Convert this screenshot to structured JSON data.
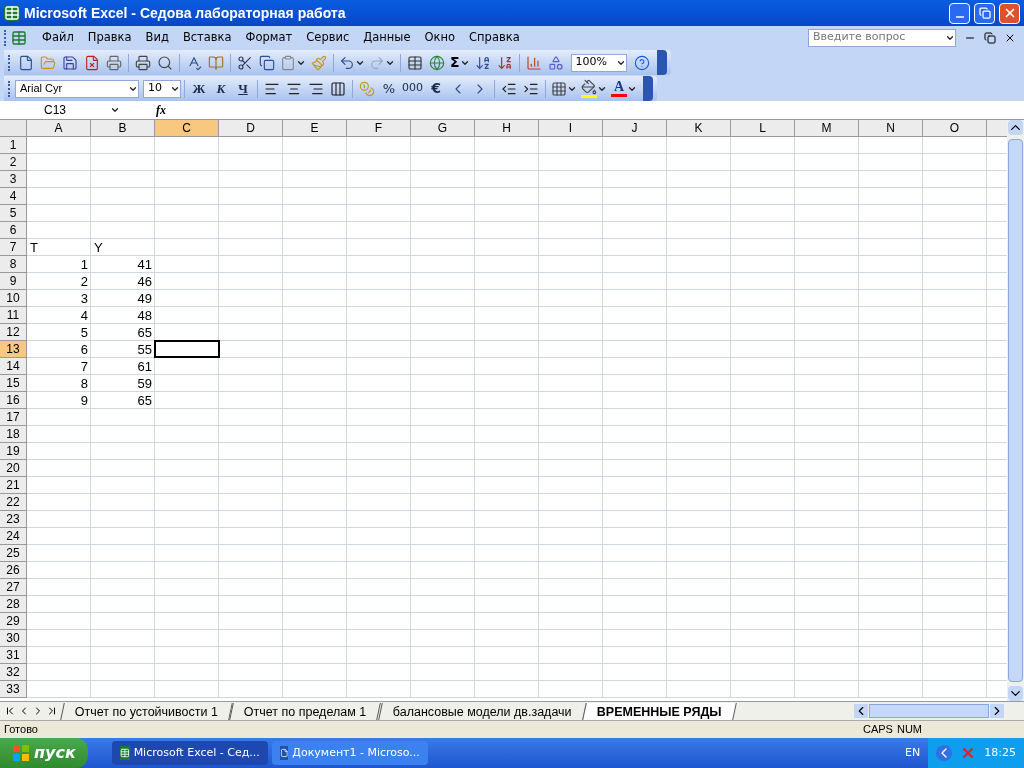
{
  "window": {
    "title": "Microsoft Excel - Седова лабораторная работа"
  },
  "menu": [
    "Файл",
    "Правка",
    "Вид",
    "Вставка",
    "Формат",
    "Сервис",
    "Данные",
    "Окно",
    "Справка"
  ],
  "help_search": {
    "placeholder": "Введите вопрос"
  },
  "toolbar_standard": {
    "sum": "Σ",
    "zoom": "100%"
  },
  "toolbar_formatting": {
    "font": "Arial Cyr",
    "size": "10",
    "bold": "Ж",
    "italic": "К",
    "underline": "Ч",
    "percent": "%",
    "thousands": "000",
    "euro": "€",
    "font_color": "A"
  },
  "formula_bar": {
    "name_box": "C13",
    "fx": "fx"
  },
  "sheet": {
    "columns": [
      {
        "label": "A",
        "selected": false
      },
      {
        "label": "B",
        "selected": false
      },
      {
        "label": "C",
        "selected": true
      },
      {
        "label": "D",
        "selected": false
      },
      {
        "label": "E",
        "selected": false
      },
      {
        "label": "F",
        "selected": false
      },
      {
        "label": "G",
        "selected": false
      },
      {
        "label": "H",
        "selected": false
      },
      {
        "label": "I",
        "selected": false
      },
      {
        "label": "J",
        "selected": false
      },
      {
        "label": "K",
        "selected": false
      },
      {
        "label": "L",
        "selected": false
      },
      {
        "label": "M",
        "selected": false
      },
      {
        "label": "N",
        "selected": false
      },
      {
        "label": "O",
        "selected": false
      }
    ],
    "rows": [
      {
        "label": "1",
        "selected": false
      },
      {
        "label": "2",
        "selected": false
      },
      {
        "label": "3",
        "selected": false
      },
      {
        "label": "4",
        "selected": false
      },
      {
        "label": "5",
        "selected": false
      },
      {
        "label": "6",
        "selected": false
      },
      {
        "label": "7",
        "selected": false,
        "cells": [
          {
            "value": "T",
            "kind": "text"
          },
          {
            "value": "Y",
            "kind": "text"
          }
        ]
      },
      {
        "label": "8",
        "selected": false,
        "cells": [
          {
            "value": "1",
            "kind": "number"
          },
          {
            "value": "41",
            "kind": "number"
          }
        ]
      },
      {
        "label": "9",
        "selected": false,
        "cells": [
          {
            "value": "2",
            "kind": "number"
          },
          {
            "value": "46",
            "kind": "number"
          }
        ]
      },
      {
        "label": "10",
        "selected": false,
        "cells": [
          {
            "value": "3",
            "kind": "number"
          },
          {
            "value": "49",
            "kind": "number"
          }
        ]
      },
      {
        "label": "11",
        "selected": false,
        "cells": [
          {
            "value": "4",
            "kind": "number"
          },
          {
            "value": "48",
            "kind": "number"
          }
        ]
      },
      {
        "label": "12",
        "selected": false,
        "cells": [
          {
            "value": "5",
            "kind": "number"
          },
          {
            "value": "65",
            "kind": "number"
          }
        ]
      },
      {
        "label": "13",
        "selected": true,
        "cells": [
          {
            "value": "6",
            "kind": "number"
          },
          {
            "value": "55",
            "kind": "number"
          }
        ]
      },
      {
        "label": "14",
        "selected": false,
        "cells": [
          {
            "value": "7",
            "kind": "number"
          },
          {
            "value": "61",
            "kind": "number"
          }
        ]
      },
      {
        "label": "15",
        "selected": false,
        "cells": [
          {
            "value": "8",
            "kind": "number"
          },
          {
            "value": "59",
            "kind": "number"
          }
        ]
      },
      {
        "label": "16",
        "selected": false,
        "cells": [
          {
            "value": "9",
            "kind": "number"
          },
          {
            "value": "65",
            "kind": "number"
          }
        ]
      },
      {
        "label": "17",
        "selected": false
      },
      {
        "label": "18",
        "selected": false
      },
      {
        "label": "19",
        "selected": false
      },
      {
        "label": "20",
        "selected": false
      },
      {
        "label": "21",
        "selected": false
      },
      {
        "label": "22",
        "selected": false
      },
      {
        "label": "23",
        "selected": false
      },
      {
        "label": "24",
        "selected": false
      },
      {
        "label": "25",
        "selected": false
      },
      {
        "label": "26",
        "selected": false
      },
      {
        "label": "27",
        "selected": false
      },
      {
        "label": "28",
        "selected": false
      },
      {
        "label": "29",
        "selected": false
      },
      {
        "label": "30",
        "selected": false
      },
      {
        "label": "31",
        "selected": false
      },
      {
        "label": "32",
        "selected": false
      },
      {
        "label": "33",
        "selected": false
      }
    ]
  },
  "sheet_tabs": [
    {
      "label": "Отчет по устойчивости 1",
      "selected": false
    },
    {
      "label": "Отчет по пределам 1",
      "selected": false
    },
    {
      "label": "балансовые модели дв.задачи",
      "selected": false
    },
    {
      "label": "ВРЕМЕННЫЕ РЯДЫ",
      "selected": true
    }
  ],
  "status_bar": {
    "message": "Готово",
    "indicators": [
      "CAPS",
      "NUM"
    ]
  },
  "taskbar": {
    "start": "пуск",
    "tasks": [
      {
        "label": "Microsoft Excel - Сед...",
        "selected": true,
        "kind": "excel"
      },
      {
        "label": "Документ1 - Microso...",
        "selected": false,
        "kind": "word"
      }
    ],
    "language": "EN",
    "time": "18:25"
  }
}
